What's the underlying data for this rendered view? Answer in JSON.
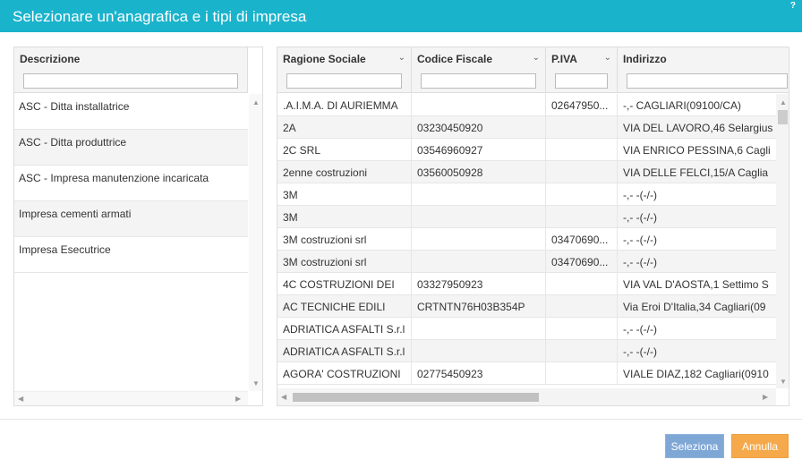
{
  "dialog": {
    "title": "Selezionare un'anagrafica e i tipi di impresa",
    "help": "?"
  },
  "left_list": {
    "header": "Descrizione",
    "filter_value": "",
    "items": [
      "ASC - Ditta installatrice",
      "ASC - Ditta produttrice",
      "ASC - Impresa manutenzione incaricata",
      "Impresa cementi armati",
      "Impresa Esecutrice"
    ]
  },
  "grid": {
    "columns": [
      "Ragione Sociale",
      "Codice Fiscale",
      "P.IVA",
      "Indirizzo"
    ],
    "rows": [
      [
        ".A.I.M.A. DI AURIEMMA",
        "",
        "02647950...",
        "-,- CAGLIARI(09100/CA)"
      ],
      [
        "2A",
        "03230450920",
        "",
        "VIA DEL LAVORO,46 Selargius"
      ],
      [
        "2C SRL",
        "03546960927",
        "",
        "VIA ENRICO PESSINA,6 Cagli"
      ],
      [
        "2enne costruzioni",
        "03560050928",
        "",
        "VIA DELLE FELCI,15/A Caglia"
      ],
      [
        "3M",
        "",
        "",
        "-,- -(-/-)"
      ],
      [
        "3M",
        "",
        "",
        "-,- -(-/-)"
      ],
      [
        "3M costruzioni srl",
        "",
        "03470690...",
        "-,- -(-/-)"
      ],
      [
        "3M costruzioni srl",
        "",
        "03470690...",
        "-,- -(-/-)"
      ],
      [
        "4C COSTRUZIONI DEI",
        "03327950923",
        "",
        "VIA VAL D'AOSTA,1 Settimo S"
      ],
      [
        "AC TECNICHE EDILI",
        "CRTNTN76H03B354P",
        "",
        "Via Eroi D'Italia,34 Cagliari(09"
      ],
      [
        "ADRIATICA ASFALTI S.r.l",
        "",
        "",
        "-,- -(-/-)"
      ],
      [
        "ADRIATICA ASFALTI S.r.l",
        "",
        "",
        "-,- -(-/-)"
      ],
      [
        "AGORA' COSTRUZIONI",
        "02775450923",
        "",
        "VIALE DIAZ,182 Cagliari(0910"
      ]
    ]
  },
  "buttons": {
    "select": "Seleziona",
    "cancel": "Annulla"
  },
  "colors": {
    "titlebar": "#1ab3cc",
    "select_button": "#7fa7d6",
    "cancel_button": "#f5a94a"
  }
}
